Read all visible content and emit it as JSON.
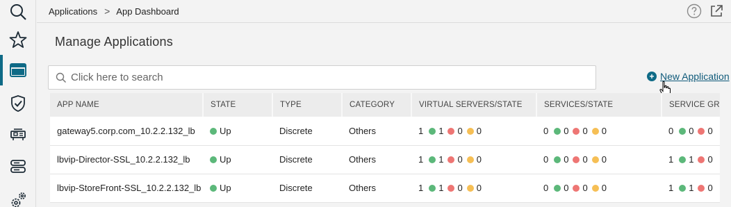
{
  "breadcrumb": {
    "parent": "Applications",
    "separator": ">",
    "current": "App Dashboard"
  },
  "page_title": "Manage Applications",
  "search": {
    "placeholder": "Click here to search",
    "value": ""
  },
  "new_app_label": "New Application",
  "colors": {
    "accent": "#0f6a86",
    "up": "#5cb87a",
    "down": "#ee7674",
    "out_of_service": "#f6bf55"
  },
  "rail_icons": [
    "search-icon",
    "star-icon",
    "app-window-icon",
    "shield-check-icon",
    "network-card-icon",
    "server-stack-icon",
    "settings-cogs-icon"
  ],
  "table": {
    "columns": [
      "APP NAME",
      "STATE",
      "TYPE",
      "CATEGORY",
      "VIRTUAL SERVERS/STATE",
      "SERVICES/STATE",
      "SERVICE GRO"
    ],
    "rows": [
      {
        "name": "gateway5.corp.com_10.2.2.132_lb",
        "state": "Up",
        "type": "Discrete",
        "category": "Others",
        "vservers": {
          "total": "1",
          "up": "1",
          "down": "0",
          "oos": "0"
        },
        "services": {
          "total": "0",
          "up": "0",
          "down": "0",
          "oos": "0"
        },
        "servicegroups": {
          "total": "0",
          "up": "0",
          "down": "0"
        }
      },
      {
        "name": "lbvip-Director-SSL_10.2.2.132_lb",
        "state": "Up",
        "type": "Discrete",
        "category": "Others",
        "vservers": {
          "total": "1",
          "up": "1",
          "down": "0",
          "oos": "0"
        },
        "services": {
          "total": "0",
          "up": "0",
          "down": "0",
          "oos": "0"
        },
        "servicegroups": {
          "total": "1",
          "up": "1",
          "down": "0"
        }
      },
      {
        "name": "lbvip-StoreFront-SSL_10.2.2.132_lb",
        "state": "Up",
        "type": "Discrete",
        "category": "Others",
        "vservers": {
          "total": "1",
          "up": "1",
          "down": "0",
          "oos": "0"
        },
        "services": {
          "total": "0",
          "up": "0",
          "down": "0",
          "oos": "0"
        },
        "servicegroups": {
          "total": "1",
          "up": "1",
          "down": "0"
        }
      }
    ]
  }
}
